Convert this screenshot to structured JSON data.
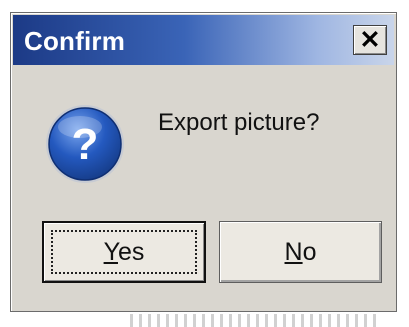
{
  "dialog": {
    "title": "Confirm",
    "close_glyph": "✕",
    "message": "Export picture?",
    "icon": "question-icon",
    "icon_glyph": "?",
    "buttons": {
      "yes": {
        "mnemonic": "Y",
        "rest": "es",
        "label": "Yes",
        "focused": true
      },
      "no": {
        "mnemonic": "N",
        "rest": "o",
        "label": "No",
        "focused": false
      }
    }
  },
  "colors": {
    "titlebar_start": "#1c3a86",
    "titlebar_end": "#c9d5ea",
    "dialog_bg": "#d9d6cf",
    "icon_blue": "#1f4fae"
  }
}
